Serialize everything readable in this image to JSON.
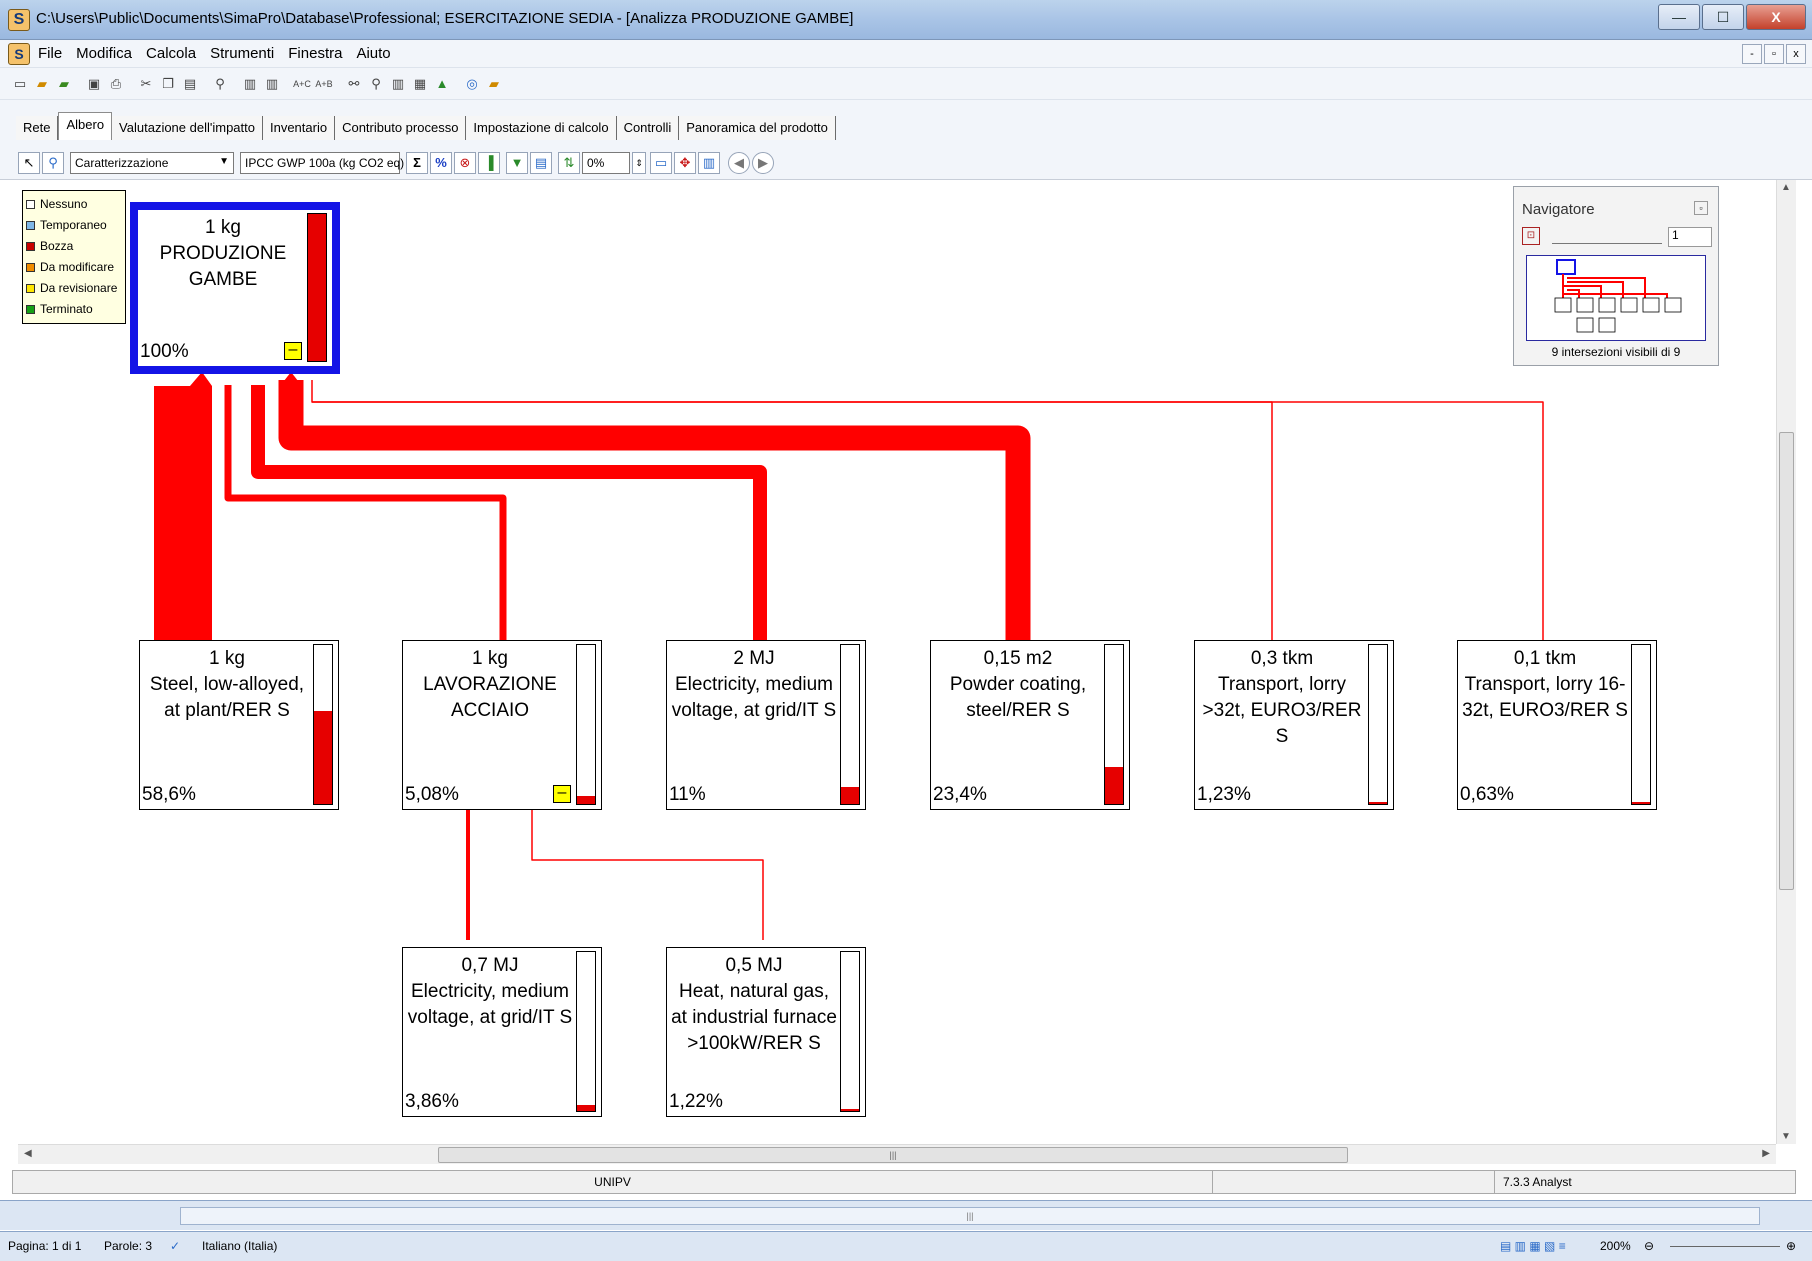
{
  "window": {
    "title": "C:\\Users\\Public\\Documents\\SimaPro\\Database\\Professional; ESERCITAZIONE SEDIA - [Analizza PRODUZIONE GAMBE]",
    "logo_glyph": "S",
    "min": "—",
    "max": "☐",
    "close": "X"
  },
  "menu": {
    "items": [
      "File",
      "Modifica",
      "Calcola",
      "Strumenti",
      "Finestra",
      "Aiuto"
    ],
    "mdi": [
      "-",
      "ᴱ",
      "x"
    ]
  },
  "tabs": [
    "Rete",
    "Albero",
    "Valutazione dell'impatto",
    "Inventario",
    "Contributo processo",
    "Impostazione di calcolo",
    "Controlli",
    "Panoramica del prodotto"
  ],
  "active_tab": "Albero",
  "analysis_toolbar": {
    "mode": "Caratterizzazione",
    "method": "IPCC GWP 100a (kg CO2 eq)",
    "sigma": "Σ",
    "percent": "%",
    "cutoff": "0%"
  },
  "legend": [
    {
      "label": "Nessuno",
      "color": "#ffffff"
    },
    {
      "label": "Temporaneo",
      "color": "#7fb7e6"
    },
    {
      "label": "Bozza",
      "color": "#c80000"
    },
    {
      "label": "Da modificare",
      "color": "#f08c00"
    },
    {
      "label": "Da revisionare",
      "color": "#ffe600"
    },
    {
      "label": "Terminato",
      "color": "#16a016"
    }
  ],
  "navigator": {
    "title": "Navigatore",
    "zoom": "1",
    "status": "9 intersezioni visibili di 9"
  },
  "tree": {
    "root": {
      "amount": "1 kg",
      "name": "PRODUZIONE GAMBE",
      "percent": "100%",
      "fill": 1.0,
      "flag": "–"
    },
    "children": [
      {
        "amount": "1 kg",
        "name": "Steel, low-alloyed, at plant/RER S",
        "percent": "58,6%",
        "fill": 0.586
      },
      {
        "amount": "1 kg",
        "name": "LAVORAZIONE ACCIAIO",
        "percent": "5,08%",
        "fill": 0.0508,
        "flag": "–"
      },
      {
        "amount": "2 MJ",
        "name": "Electricity, medium voltage, at grid/IT S",
        "percent": "11%",
        "fill": 0.11
      },
      {
        "amount": "0,15 m2",
        "name": "Powder coating, steel/RER S",
        "percent": "23,4%",
        "fill": 0.234
      },
      {
        "amount": "0,3 tkm",
        "name": "Transport, lorry >32t, EURO3/RER S",
        "percent": "1,23%",
        "fill": 0.0123
      },
      {
        "amount": "0,1 tkm",
        "name": "Transport, lorry 16-32t, EURO3/RER S",
        "percent": "0,63%",
        "fill": 0.0063
      }
    ],
    "grandchildren": [
      {
        "amount": "0,7 MJ",
        "name": "Electricity, medium voltage, at grid/IT S",
        "percent": "3,86%",
        "fill": 0.0386
      },
      {
        "amount": "0,5 MJ",
        "name": "Heat, natural gas, at industrial furnace >100kW/RER S",
        "percent": "1,22%",
        "fill": 0.0122
      }
    ]
  },
  "flow_color": "#ff0000",
  "root_border_color": "#1414e6",
  "status": {
    "center": "UNIPV",
    "version": "7.3.3 Analyst"
  },
  "word_status": {
    "page": "Pagina: 1 di 1",
    "words": "Parole: 3",
    "language": "Italiano (Italia)",
    "zoom": "200%"
  }
}
